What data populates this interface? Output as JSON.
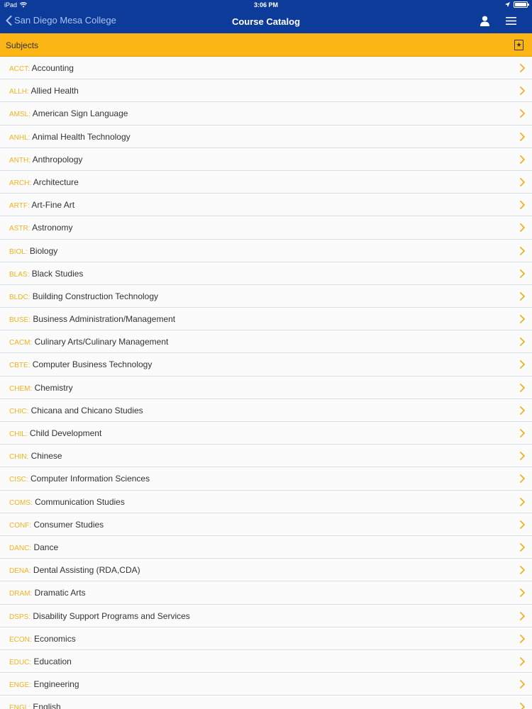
{
  "status": {
    "device": "iPad",
    "time": "3:06 PM"
  },
  "nav": {
    "back_label": "San Diego Mesa College",
    "title": "Course Catalog"
  },
  "section": {
    "title": "Subjects"
  },
  "colors": {
    "nav_bg": "#0d3b9a",
    "accent": "#fbb515",
    "code_text": "#f0b21e"
  },
  "icons": {
    "back": "chevron-left-icon",
    "user": "user-icon",
    "menu": "hamburger-menu-icon",
    "favorites": "star-bookmark-icon",
    "row": "chevron-right-icon"
  },
  "subjects": [
    {
      "code": "ACCT:",
      "name": "Accounting"
    },
    {
      "code": "ALLH:",
      "name": "Allied Health"
    },
    {
      "code": "AMSL:",
      "name": "American Sign Language"
    },
    {
      "code": "ANHL:",
      "name": "Animal Health Technology"
    },
    {
      "code": "ANTH:",
      "name": "Anthropology"
    },
    {
      "code": "ARCH:",
      "name": "Architecture"
    },
    {
      "code": "ARTF:",
      "name": "Art-Fine Art"
    },
    {
      "code": "ASTR:",
      "name": "Astronomy"
    },
    {
      "code": "BIOL:",
      "name": "Biology"
    },
    {
      "code": "BLAS:",
      "name": "Black Studies"
    },
    {
      "code": "BLDC:",
      "name": "Building Construction Technology"
    },
    {
      "code": "BUSE:",
      "name": "Business Administration/Management"
    },
    {
      "code": "CACM:",
      "name": "Culinary Arts/Culinary Management"
    },
    {
      "code": "CBTE:",
      "name": "Computer Business Technology"
    },
    {
      "code": "CHEM:",
      "name": "Chemistry"
    },
    {
      "code": "CHIC:",
      "name": "Chicana and Chicano Studies"
    },
    {
      "code": "CHIL:",
      "name": "Child Development"
    },
    {
      "code": "CHIN:",
      "name": "Chinese"
    },
    {
      "code": "CISC:",
      "name": "Computer Information Sciences"
    },
    {
      "code": "COMS:",
      "name": "Communication Studies"
    },
    {
      "code": "CONF:",
      "name": "Consumer Studies"
    },
    {
      "code": "DANC:",
      "name": "Dance"
    },
    {
      "code": "DENA:",
      "name": "Dental Assisting (RDA,CDA)"
    },
    {
      "code": "DRAM:",
      "name": "Dramatic Arts"
    },
    {
      "code": "DSPS:",
      "name": "Disability Support Programs and Services"
    },
    {
      "code": "ECON:",
      "name": "Economics"
    },
    {
      "code": "EDUC:",
      "name": "Education"
    },
    {
      "code": "ENGE:",
      "name": "Engineering"
    },
    {
      "code": "ENGL:",
      "name": "English"
    }
  ]
}
